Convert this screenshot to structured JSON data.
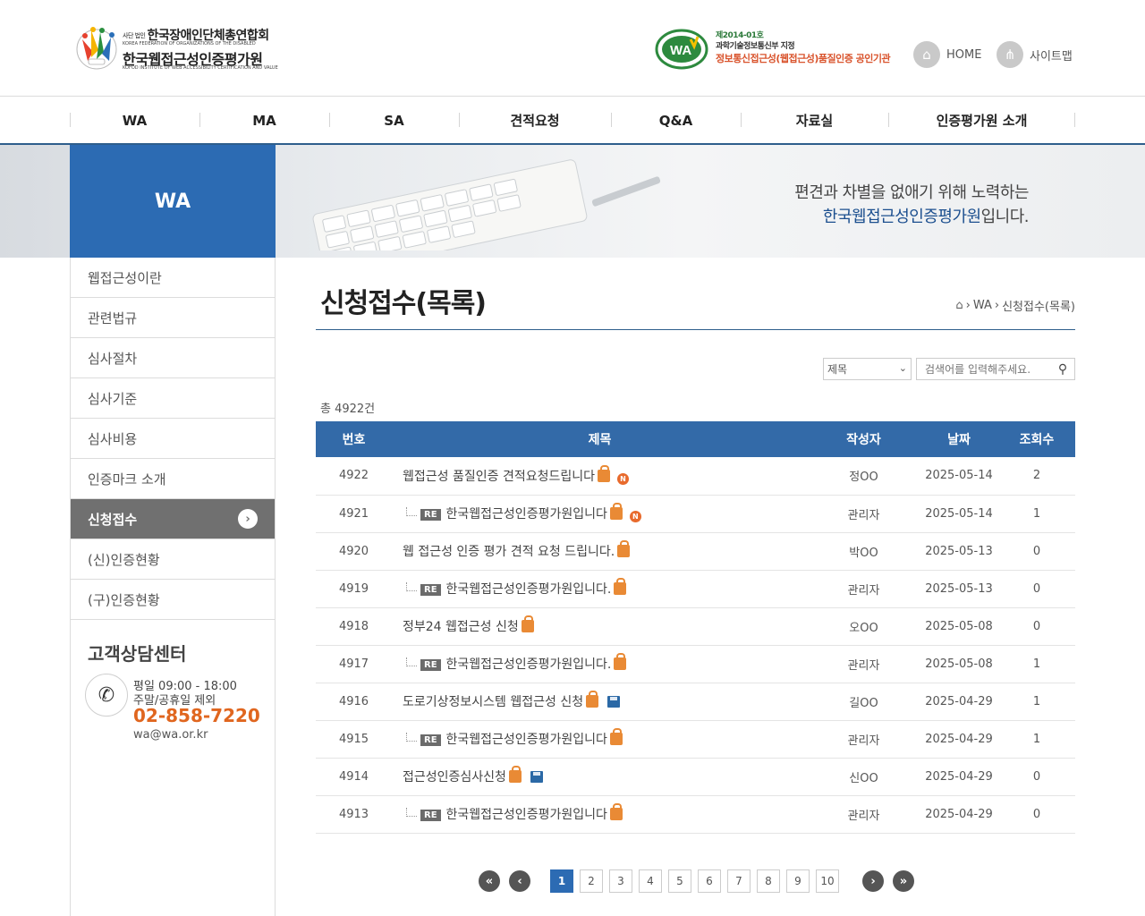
{
  "header": {
    "org1_prefix": "사단 법인",
    "org1": "한국장애인단체총연합회",
    "org1_en": "KOREA FEDERATION OF ORGANIZATIONS OF THE DISABLED",
    "org2": "한국웹접근성인증평가원",
    "org2_en": "KOFOD INSTITUTE OF WEB ACCESSIBILITY CERTIFICATION AND VALUE",
    "cert_no": "제2014-01호",
    "cert_ministry": "과학기술정보통신부 지정",
    "cert_desc": "정보통신접근성(웹접근성)품질인증 공인기관",
    "home_label": "HOME",
    "sitemap_label": "사이트맵"
  },
  "gnb": [
    "WA",
    "MA",
    "SA",
    "견적요청",
    "Q&A",
    "자료실",
    "인증평가원 소개"
  ],
  "visual": {
    "section_title": "WA",
    "copy_line1": "편견과 차별을 없애기 위해 노력하는",
    "copy_hl": "한국웹접근성인증평가원",
    "copy_tail": "입니다."
  },
  "lnb": {
    "items": [
      "웹접근성이란",
      "관련법규",
      "심사절차",
      "심사기준",
      "심사비용",
      "인증마크 소개",
      "신청접수",
      "(신)인증현황",
      "(구)인증현황"
    ],
    "active_index": 6,
    "cs_title": "고객상담센터",
    "hours1": "평일 09:00 - 18:00",
    "hours2": "주말/공휴일 제외",
    "tel": "02-858-7220",
    "mail": "wa@wa.or.kr"
  },
  "content": {
    "page_title": "신청접수(목록)",
    "breadcrumb": [
      "WA",
      "신청접수(목록)"
    ],
    "search_select": "제목",
    "search_placeholder": "검색어를 입력해주세요.",
    "total": "총 4922건",
    "columns": [
      "번호",
      "제목",
      "작성자",
      "날짜",
      "조회수"
    ],
    "rows": [
      {
        "no": "4922",
        "title": "웹접근성 품질인증 견적요청드립니다",
        "reply": false,
        "new": true,
        "file": false,
        "author": "정OO",
        "date": "2025-05-14",
        "views": "2"
      },
      {
        "no": "4921",
        "title": "한국웹접근성인증평가원입니다",
        "reply": true,
        "new": true,
        "file": false,
        "author": "관리자",
        "date": "2025-05-14",
        "views": "1"
      },
      {
        "no": "4920",
        "title": "웹 접근성 인증 평가 견적 요청 드립니다.",
        "reply": false,
        "new": false,
        "file": false,
        "author": "박OO",
        "date": "2025-05-13",
        "views": "0"
      },
      {
        "no": "4919",
        "title": "한국웹접근성인증평가원입니다.",
        "reply": true,
        "new": false,
        "file": false,
        "author": "관리자",
        "date": "2025-05-13",
        "views": "0"
      },
      {
        "no": "4918",
        "title": "정부24 웹접근성 신청",
        "reply": false,
        "new": false,
        "file": false,
        "author": "오OO",
        "date": "2025-05-08",
        "views": "0"
      },
      {
        "no": "4917",
        "title": "한국웹접근성인증평가원입니다.",
        "reply": true,
        "new": false,
        "file": false,
        "author": "관리자",
        "date": "2025-05-08",
        "views": "1"
      },
      {
        "no": "4916",
        "title": "도로기상정보시스템 웹접근성 신청",
        "reply": false,
        "new": false,
        "file": true,
        "author": "길OO",
        "date": "2025-04-29",
        "views": "1"
      },
      {
        "no": "4915",
        "title": "한국웹접근성인증평가원입니다",
        "reply": true,
        "new": false,
        "file": false,
        "author": "관리자",
        "date": "2025-04-29",
        "views": "1"
      },
      {
        "no": "4914",
        "title": "접근성인증심사신청",
        "reply": false,
        "new": false,
        "file": true,
        "author": "신OO",
        "date": "2025-04-29",
        "views": "0"
      },
      {
        "no": "4913",
        "title": "한국웹접근성인증평가원입니다",
        "reply": true,
        "new": false,
        "file": false,
        "author": "관리자",
        "date": "2025-04-29",
        "views": "0"
      }
    ],
    "re_label": "RE",
    "pages": [
      "1",
      "2",
      "3",
      "4",
      "5",
      "6",
      "7",
      "8",
      "9",
      "10"
    ],
    "current_page": "1"
  }
}
